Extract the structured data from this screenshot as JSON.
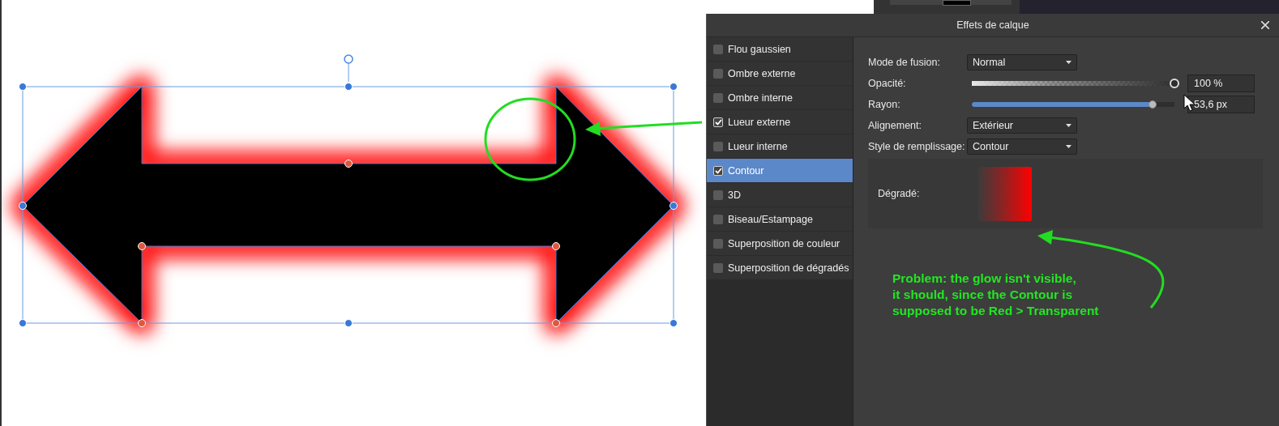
{
  "dialog": {
    "title": "Effets de calque",
    "effects": [
      {
        "label": "Flou gaussien",
        "checked": false,
        "selected": false
      },
      {
        "label": "Ombre externe",
        "checked": false,
        "selected": false
      },
      {
        "label": "Ombre interne",
        "checked": false,
        "selected": false
      },
      {
        "label": "Lueur externe",
        "checked": true,
        "selected": false
      },
      {
        "label": "Lueur interne",
        "checked": false,
        "selected": false
      },
      {
        "label": "Contour",
        "checked": true,
        "selected": true
      },
      {
        "label": "3D",
        "checked": false,
        "selected": false
      },
      {
        "label": "Biseau/Estampage",
        "checked": false,
        "selected": false
      },
      {
        "label": "Superposition de couleur",
        "checked": false,
        "selected": false
      },
      {
        "label": "Superposition de dégradés",
        "checked": false,
        "selected": false
      }
    ],
    "fields": [
      {
        "kind": "dropdown",
        "label": "Mode de fusion:",
        "value": "Normal"
      },
      {
        "kind": "opacity-slider",
        "label": "Opacité:",
        "level": 1,
        "value": "100 %"
      },
      {
        "kind": "slider",
        "label": "Rayon:",
        "level": 0.89,
        "value": "53,6 px"
      },
      {
        "kind": "dropdown",
        "label": "Alignement:",
        "value": "Extérieur"
      },
      {
        "kind": "dropdown",
        "label": "Style de remplissage:",
        "value": "Contour"
      }
    ],
    "gradient": {
      "label": "Dégradé:"
    }
  },
  "annotation": {
    "lines": [
      "Problem: the glow isn't visible,",
      "it should, since the Contour is",
      "supposed to be Red > Transparent"
    ]
  }
}
